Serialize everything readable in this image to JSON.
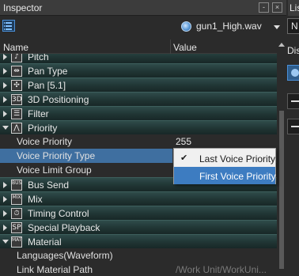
{
  "inspector": {
    "title": "Inspector",
    "pin_glyph": "-",
    "close_glyph": "×",
    "object_name": "gun1_High.wav",
    "object_icon": "sound-wave-icon"
  },
  "columns": {
    "name": "Name",
    "value": "Value"
  },
  "rows": [
    {
      "type": "cat",
      "label": "Pitch",
      "icon": "pitch-icon",
      "icon_glyph": "♪",
      "expanded": false
    },
    {
      "type": "cat",
      "label": "Pan Type",
      "icon": "pan-type-icon",
      "icon_glyph": "⇹",
      "expanded": false
    },
    {
      "type": "cat",
      "label": "Pan [5.1]",
      "icon": "pan-51-icon",
      "icon_glyph": "✣",
      "expanded": false
    },
    {
      "type": "cat",
      "label": "3D Positioning",
      "icon": "3d-positioning-icon",
      "icon_glyph": "3D",
      "expanded": false
    },
    {
      "type": "cat",
      "label": "Filter",
      "icon": "filter-icon",
      "icon_glyph": "☰",
      "expanded": false
    },
    {
      "type": "cat",
      "label": "Priority",
      "icon": "priority-icon",
      "icon_glyph": "⋀",
      "expanded": true
    },
    {
      "type": "prop",
      "label": "Voice Priority",
      "value": "255"
    },
    {
      "type": "prop",
      "label": "Voice Priority Type",
      "value": "",
      "selected": true
    },
    {
      "type": "prop",
      "label": "Voice Limit Group",
      "value": ""
    },
    {
      "type": "cat",
      "label": "Bus Send",
      "icon": "bus-send-icon",
      "icon_glyph": "BUS",
      "expanded": false
    },
    {
      "type": "cat",
      "label": "Mix",
      "icon": "mix-icon",
      "icon_glyph": "MIX",
      "expanded": false
    },
    {
      "type": "cat",
      "label": "Timing Control",
      "icon": "timing-control-icon",
      "icon_glyph": "⏱",
      "expanded": false
    },
    {
      "type": "cat",
      "label": "Special Playback",
      "icon": "special-playback-icon",
      "icon_glyph": "SP",
      "expanded": false
    },
    {
      "type": "cat",
      "label": "Material",
      "icon": "material-icon",
      "icon_glyph": "MAT",
      "expanded": true
    },
    {
      "type": "prop",
      "label": "Languages(Waveform)",
      "value": ""
    },
    {
      "type": "prop",
      "label": "Link Material Path",
      "value": "/Work Unit/WorkUni...",
      "dim": true
    }
  ],
  "dropdown": {
    "options": [
      {
        "label": "Last Voice Priority",
        "checked": true,
        "check_glyph": "✔",
        "highlighted": false
      },
      {
        "label": "First Voice Priority",
        "checked": false,
        "check_glyph": "",
        "highlighted": true
      }
    ]
  },
  "right_panel": {
    "tab_title": "List",
    "field_text": "N",
    "section_label": "Display",
    "colors": {
      "accent": "#3d7cc1",
      "category_row": "#203534"
    }
  }
}
